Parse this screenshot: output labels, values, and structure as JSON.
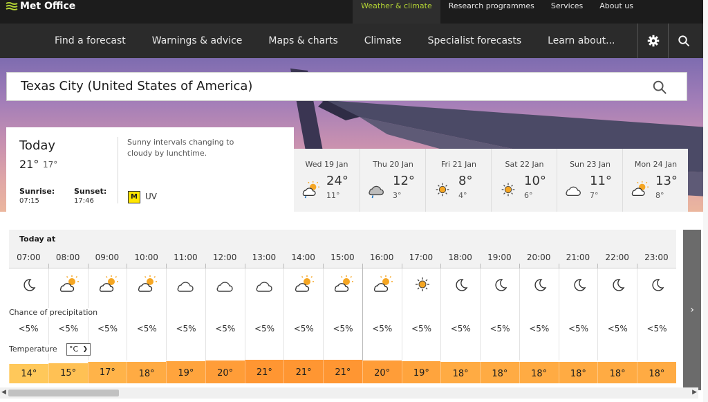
{
  "brand": {
    "name": "Met Office"
  },
  "topnav": [
    "Weather & climate",
    "Research programmes",
    "Services",
    "About us"
  ],
  "mainnav": [
    "Find a forecast",
    "Warnings & advice",
    "Maps & charts",
    "Climate",
    "Specialist forecasts",
    "Learn about..."
  ],
  "search": {
    "value": "Texas City (United States of America)"
  },
  "today": {
    "title": "Today",
    "max": "21°",
    "min": "17°",
    "sunrise_label": "Sunrise:",
    "sunrise": "07:15",
    "sunset_label": "Sunset:",
    "sunset": "17:46",
    "summary": "Sunny intervals changing to cloudy by lunchtime.",
    "uv_level": "M",
    "uv_label": "UV"
  },
  "days": [
    {
      "date": "Wed 19 Jan",
      "max": "24°",
      "min": "11°",
      "icon": "sun-cloud-rain-icon"
    },
    {
      "date": "Thu 20 Jan",
      "max": "12°",
      "min": "3°",
      "icon": "cloud-rain-icon"
    },
    {
      "date": "Fri 21 Jan",
      "max": "8°",
      "min": "4°",
      "icon": "sun-icon"
    },
    {
      "date": "Sat 22 Jan",
      "max": "10°",
      "min": "6°",
      "icon": "sun-icon"
    },
    {
      "date": "Sun 23 Jan",
      "max": "11°",
      "min": "7°",
      "icon": "cloud-icon"
    },
    {
      "date": "Mon 24 Jan",
      "max": "13°",
      "min": "8°",
      "icon": "sun-cloud-icon"
    }
  ],
  "hourly": {
    "heading": "Today at",
    "precip_label": "Chance of precipitation",
    "temp_label": "Temperature",
    "unit": "°C",
    "hours": [
      "07:00",
      "08:00",
      "09:00",
      "10:00",
      "11:00",
      "12:00",
      "13:00",
      "14:00",
      "15:00",
      "16:00",
      "17:00",
      "18:00",
      "19:00",
      "20:00",
      "21:00",
      "22:00",
      "23:00"
    ],
    "icons": [
      "moon-icon",
      "sun-cloud-icon",
      "sun-cloud-icon",
      "sun-cloud-icon",
      "cloud-icon",
      "cloud-icon",
      "cloud-icon",
      "sun-cloud-icon",
      "sun-cloud-icon",
      "sun-cloud-icon",
      "sun-icon",
      "moon-icon",
      "moon-icon",
      "moon-icon",
      "moon-icon",
      "moon-icon",
      "moon-icon"
    ],
    "precip": [
      "<5%",
      "<5%",
      "<5%",
      "<5%",
      "<5%",
      "<5%",
      "<5%",
      "<5%",
      "<5%",
      "<5%",
      "<5%",
      "<5%",
      "<5%",
      "<5%",
      "<5%",
      "<5%",
      "<5%"
    ],
    "temps": [
      "14°",
      "15°",
      "17°",
      "18°",
      "19°",
      "20°",
      "21°",
      "21°",
      "21°",
      "20°",
      "19°",
      "18°",
      "18°",
      "18°",
      "18°",
      "18°",
      "18°"
    ],
    "temp_values": [
      14,
      15,
      17,
      18,
      19,
      20,
      21,
      21,
      21,
      20,
      19,
      18,
      18,
      18,
      18,
      18,
      18
    ]
  },
  "colors": {
    "accent": "#b3d334",
    "uv_moderate": "#ffe600"
  }
}
